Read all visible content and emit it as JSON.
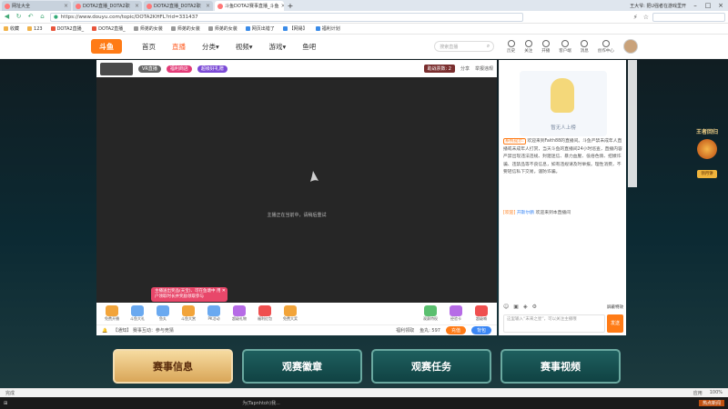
{
  "browser": {
    "tabs": [
      {
        "label": "网址大全",
        "active": false
      },
      {
        "label": "DOTA2直播_DOTA2职",
        "active": false
      },
      {
        "label": "DOTA2直播_DOTA2职",
        "active": false
      },
      {
        "label": "斗鱼DOTA2赛事直播_斗鱼",
        "active": true
      }
    ],
    "window_user": "王大爷: 把U强者在游戏里开",
    "url": "https://www.douyu.com/topic/DOTA2KHFL?rid=331437",
    "bookmarks": [
      {
        "label": "收藏",
        "icon": "star-icon"
      },
      {
        "label": "123",
        "icon": "folder-icon"
      },
      {
        "label": "DOTA2直播_",
        "icon": "douyu-icon"
      },
      {
        "label": "DOTA2直播_",
        "icon": "douyu-icon"
      },
      {
        "label": "师弟的女装",
        "icon": "page-icon"
      },
      {
        "label": "师弟的女装",
        "icon": "page-icon"
      },
      {
        "label": "师弟的女装",
        "icon": "page-icon"
      },
      {
        "label": "网页出错了",
        "icon": "page-icon"
      },
      {
        "label": "【网易】",
        "icon": "page-icon"
      },
      {
        "label": "福利计划",
        "icon": "page-icon"
      }
    ]
  },
  "douyu": {
    "logo": "斗鱼",
    "nav": [
      {
        "label": "首页",
        "active": false
      },
      {
        "label": "直播",
        "active": true
      },
      {
        "label": "分类▾",
        "active": false
      },
      {
        "label": "视频▾",
        "active": false
      },
      {
        "label": "游戏▾",
        "active": false
      },
      {
        "label": "鱼吧",
        "active": false
      }
    ],
    "search_placeholder": "搜索直播",
    "tools": [
      "历史",
      "关注",
      "开播",
      "客户端",
      "消息",
      "创作中心"
    ]
  },
  "video": {
    "top_pills": [
      {
        "label": "VR直播",
        "style": "gray"
      },
      {
        "label": "福利商店",
        "style": "pink"
      },
      {
        "label": "超级好礼赠",
        "style": "purple"
      }
    ],
    "feed_count": "助战票数: 2",
    "share": "分享",
    "report": "举报违规",
    "loading": "主播正在当前中，请稍后重试",
    "popup": "主播送出奖品(天宝)、可在鱼塘中 用户领取时长并奖励领取参与",
    "popup_close": "✕",
    "gifts": [
      {
        "label": "免费开播",
        "color": "#f2a43a"
      },
      {
        "label": "斗鱼大礼",
        "color": "#6aa9f0"
      },
      {
        "label": "鱼丸",
        "color": "#6aa9f0"
      },
      {
        "label": "斗鱼大赏",
        "color": "#f2a43a"
      },
      {
        "label": "PK活动",
        "color": "#6aa9f0"
      },
      {
        "label": "超级礼物",
        "color": "#b66be6"
      },
      {
        "label": "福利红包",
        "color": "#ef4f4f"
      },
      {
        "label": "免费大奖",
        "color": "#f2a43a"
      }
    ],
    "gifts_right": [
      {
        "label": "观赛特权",
        "color": "#5abf6f"
      },
      {
        "label": "经验卡",
        "color": "#b66be6"
      },
      {
        "label": "超级喊",
        "color": "#ef4f4f"
      }
    ],
    "bottom_left": "【通知】 赛事互动：参与竞猜",
    "bottom_mid": "福利领取",
    "bottom_count": "鱼丸: 597",
    "btn_primary": "充值",
    "btn_secondary": "背包"
  },
  "chat": {
    "illus_caption": "暂无人上榜",
    "system_tag": "系统提示:",
    "system_msg": "欢迎来到Faith88的直播间。斗鱼严禁未成年人直播或未成年人打赏，当天斗鱼的直播间24小时巡查，直播内容严禁出现违法违规、封建迷信、暴力血腥、低俗色情、招嫖诈骗、违禁品等不良信息，如有违规请及时举报。理性消费，不要轻信私下交易，谨防诈骗。",
    "welcome_tag": "[欢迎]",
    "welcome_user": "开斯尔鹏",
    "welcome_msg": "欢迎来到本直播间",
    "tool_right": "屏蔽特效",
    "input_placeholder": "这里输入“末来之星”，可以关注主播哦",
    "send": "发送"
  },
  "side_banner": {
    "title": "王者回归",
    "button": "领月饼"
  },
  "bottom_tabs": [
    {
      "label": "赛事信息",
      "active": true
    },
    {
      "label": "观赛徽章",
      "active": false
    },
    {
      "label": "观赛任务",
      "active": false
    },
    {
      "label": "赛事视频",
      "active": false
    }
  ],
  "statusbar": {
    "left": "完成",
    "right": [
      "应用",
      "100%"
    ]
  },
  "taskbar": {
    "download": "为(Tapnhtoh)我...",
    "right": "热点新闻"
  }
}
